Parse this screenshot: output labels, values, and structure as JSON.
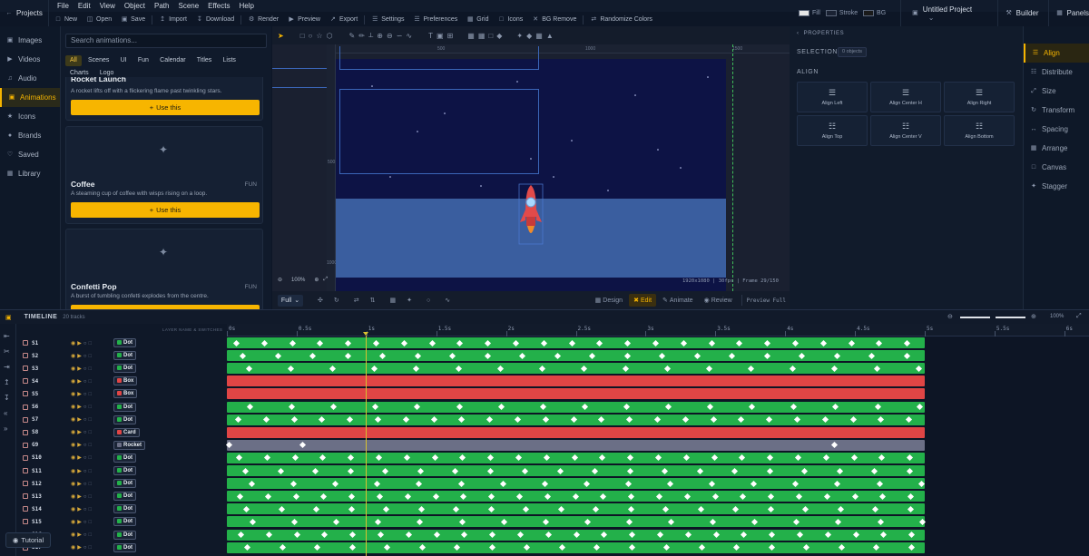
{
  "app": {
    "projects_label": "Projects",
    "project_name": "Untitled Project",
    "builder_label": "Builder",
    "panels_label": "Panels"
  },
  "menus": [
    "File",
    "Edit",
    "View",
    "Object",
    "Path",
    "Scene",
    "Effects",
    "Help"
  ],
  "toolbar": {
    "new": "New",
    "open": "Open",
    "save": "Save",
    "import": "Import",
    "download": "Download",
    "render": "Render",
    "preview": "Preview",
    "export": "Export",
    "settings": "Settings",
    "preferences": "Preferences",
    "grid": "Grid",
    "icons": "Icons",
    "bg_remove": "BG Remove",
    "randomize": "Randomize Colors"
  },
  "fill_stroke": {
    "fill": "Fill",
    "stroke": "Stroke",
    "bg": "BG",
    "fill_color": "#e6e6e6",
    "stroke_color": "#1a2233",
    "bg_color": "#1a1a1a"
  },
  "leftnav": [
    {
      "label": "Images",
      "icon": "image-icon"
    },
    {
      "label": "Videos",
      "icon": "video-icon"
    },
    {
      "label": "Audio",
      "icon": "audio-icon"
    },
    {
      "label": "Animations",
      "icon": "animation-icon",
      "active": true
    },
    {
      "label": "Icons",
      "icon": "icons-icon"
    },
    {
      "label": "Brands",
      "icon": "brand-icon"
    },
    {
      "label": "Saved",
      "icon": "saved-icon"
    },
    {
      "label": "Library",
      "icon": "library-icon"
    }
  ],
  "animations": {
    "search_placeholder": "Search animations...",
    "filters": [
      "All",
      "Scenes",
      "UI",
      "Fun",
      "Calendar",
      "Titles",
      "Lists",
      "Charts",
      "Logo"
    ],
    "cards": [
      {
        "title": "Rocket Launch",
        "tag": "",
        "desc": "A rocket lifts off with a flickering flame past twinkling stars."
      },
      {
        "title": "Coffee",
        "tag": "FUN",
        "desc": "A steaming cup of coffee with wisps rising on a loop."
      },
      {
        "title": "Confetti Pop",
        "tag": "FUN",
        "desc": "A burst of tumbling confetti explodes from the centre."
      }
    ],
    "use_label": "Use this"
  },
  "canvas": {
    "rulers_top": [
      "500",
      "1000",
      "1500"
    ],
    "rulers_left": [
      "500",
      "1000"
    ],
    "zoom": "100%",
    "size_readout": "1920x1080 | 30fps",
    "frame_readout": "Frame 29/150",
    "full_label": "Full",
    "modes": {
      "design": "Design",
      "edit": "Edit",
      "animate": "Animate",
      "review": "Review"
    },
    "preview_full": "Preview Full"
  },
  "properties": {
    "title": "PROPERTIES",
    "selection_label": "SELECTION",
    "selection_value": "0 objects",
    "align_header": "ALIGN",
    "align_buttons": [
      "Align Left",
      "Align Center H",
      "Align Right",
      "Align Top",
      "Align Center V",
      "Align Bottom"
    ]
  },
  "propnav": [
    {
      "label": "Align",
      "icon": "align-icon",
      "active": true
    },
    {
      "label": "Distribute",
      "icon": "distribute-icon"
    },
    {
      "label": "Size",
      "icon": "size-icon"
    },
    {
      "label": "Transform",
      "icon": "transform-icon"
    },
    {
      "label": "Spacing",
      "icon": "spacing-icon"
    },
    {
      "label": "Arrange",
      "icon": "arrange-icon"
    },
    {
      "label": "Canvas",
      "icon": "canvas-icon"
    },
    {
      "label": "Stagger",
      "icon": "stagger-icon"
    }
  ],
  "timeline": {
    "title": "TIMELINE",
    "tracks_count": "20 tracks",
    "zoom": "100%",
    "header_hint": "LAYER NAME & SWITCHES",
    "ticks": [
      "0s",
      "0.5s",
      "1s",
      "1.5s",
      "2s",
      "2.5s",
      "3s",
      "3.5s",
      "4s",
      "4.5s",
      "5s",
      "5.5s",
      "6s"
    ],
    "playhead_time": 1.0,
    "colors": {
      "dot": "#23b04a",
      "box": "#e04545",
      "card": "#e04545",
      "rocket": "#6b6f86"
    },
    "tracks": [
      {
        "name": "S1",
        "type": "Dot"
      },
      {
        "name": "S2",
        "type": "Dot"
      },
      {
        "name": "S3",
        "type": "Dot"
      },
      {
        "name": "S4",
        "type": "Box"
      },
      {
        "name": "S5",
        "type": "Box"
      },
      {
        "name": "S6",
        "type": "Dot"
      },
      {
        "name": "S7",
        "type": "Dot"
      },
      {
        "name": "S8",
        "type": "Card"
      },
      {
        "name": "G9",
        "type": "Rocket"
      },
      {
        "name": "S10",
        "type": "Dot"
      },
      {
        "name": "S11",
        "type": "Dot"
      },
      {
        "name": "S12",
        "type": "Dot"
      },
      {
        "name": "S13",
        "type": "Dot"
      },
      {
        "name": "S14",
        "type": "Dot"
      },
      {
        "name": "S15",
        "type": "Dot"
      },
      {
        "name": "S16",
        "type": "Dot"
      },
      {
        "name": "S17",
        "type": "Dot"
      }
    ]
  },
  "tutorial_label": "Tutorial"
}
